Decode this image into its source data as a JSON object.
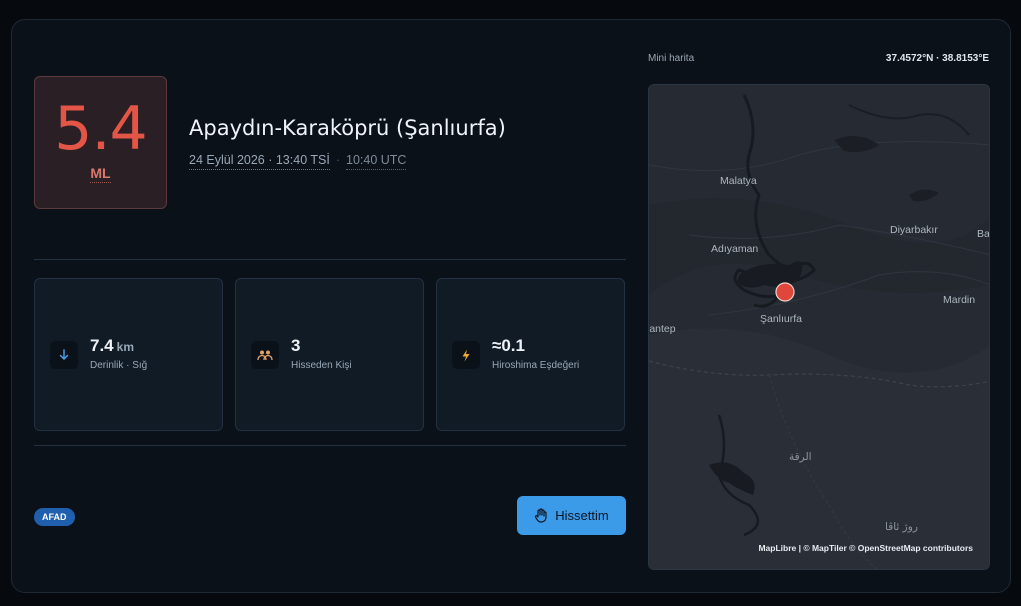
{
  "magnitude": {
    "value": "5.4",
    "scale": "ML"
  },
  "location": "Apaydın-Karaköprü (Şanlıurfa)",
  "datetime": {
    "local": "24 Eylül 2026 · 13:40 TSİ",
    "separator": "·",
    "utc": "10:40 UTC"
  },
  "stats": [
    {
      "icon": "arrow-down-icon",
      "value": "7.4",
      "unit": "km",
      "label": "Derinlik · Sığ"
    },
    {
      "icon": "people-icon",
      "value": "3",
      "unit": "",
      "label": "Hisseden Kişi"
    },
    {
      "icon": "lightning-icon",
      "value": "≈0.1",
      "unit": "",
      "label": "Hiroshima Eşdeğeri"
    }
  ],
  "source_badge": "AFAD",
  "felt_button": {
    "label": "Hissettim",
    "icon": "hand-icon"
  },
  "map": {
    "title": "Mini harita",
    "coordinates": "37.4572°N · 38.8153°E",
    "places": [
      "Malatya",
      "Diyarbakır",
      "Adıyaman",
      "Ba",
      "Mardin",
      "iantep",
      "Şanlıurfa",
      "الرقة",
      "روژ ئاڤا"
    ],
    "attribution": "MapLibre | © MapTiler © OpenStreetMap contributors"
  },
  "colors": {
    "accent": "#3b9be9",
    "magnitude": "#e35647",
    "marker": "#e0473a",
    "badge": "#1f5fae"
  }
}
